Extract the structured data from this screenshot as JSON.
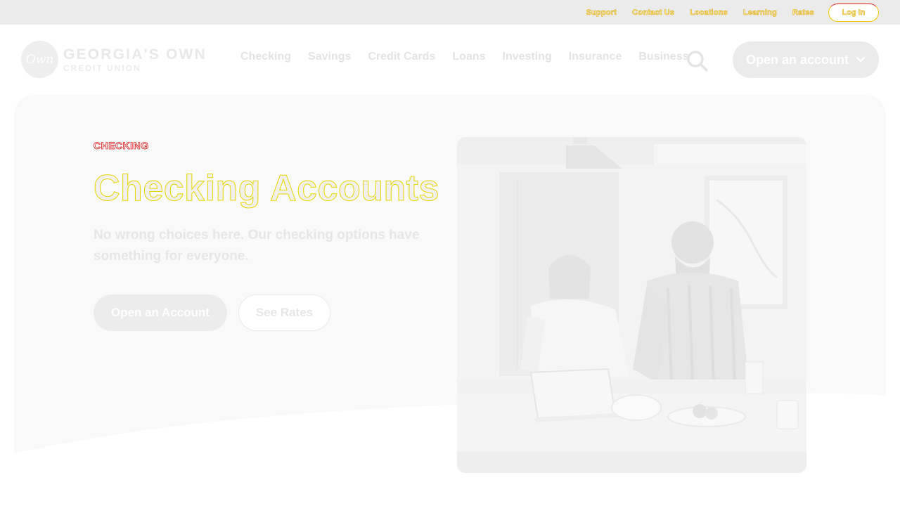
{
  "utility_nav": {
    "links": [
      "Support",
      "Contact Us",
      "Locations",
      "Learning",
      "Rates"
    ],
    "login_label": "Log In"
  },
  "logo": {
    "mark": "Own",
    "name": "GEORGIA'S OWN",
    "subtitle": "CREDIT UNION"
  },
  "main_nav": {
    "items": [
      "Checking",
      "Savings",
      "Credit Cards",
      "Loans",
      "Investing",
      "Insurance",
      "Business"
    ],
    "search_icon": "search-icon",
    "open_account_label": "Open an account"
  },
  "hero": {
    "eyebrow": "CHECKING",
    "title": "Checking Accounts",
    "description": "No wrong choices here. Our checking options have something for everyone.",
    "primary_cta": "Open an Account",
    "secondary_cta": "See Rates"
  },
  "colors": {
    "eyebrow_outline": "#d81f1f",
    "title_outline": "#e6d600",
    "accent_yellow": "#f1c400"
  }
}
